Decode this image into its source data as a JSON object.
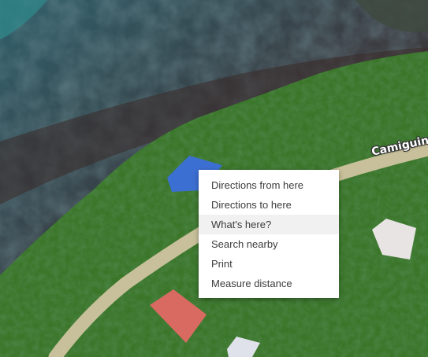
{
  "map": {
    "road_label": "Camiguin",
    "colors": {
      "sea": "#2c4a56",
      "reef": "#3a2f2a",
      "vegetation": "#3d7a2a",
      "road": "#c9c29a",
      "red_roof": "#d86060",
      "blue_roof": "#3a6ad0"
    }
  },
  "context_menu": {
    "items": [
      {
        "label": "Directions from here"
      },
      {
        "label": "Directions to here"
      },
      {
        "label": "What's here?"
      },
      {
        "label": "Search nearby"
      },
      {
        "label": "Print"
      },
      {
        "label": "Measure distance"
      }
    ],
    "hovered_item": "What's here?"
  }
}
